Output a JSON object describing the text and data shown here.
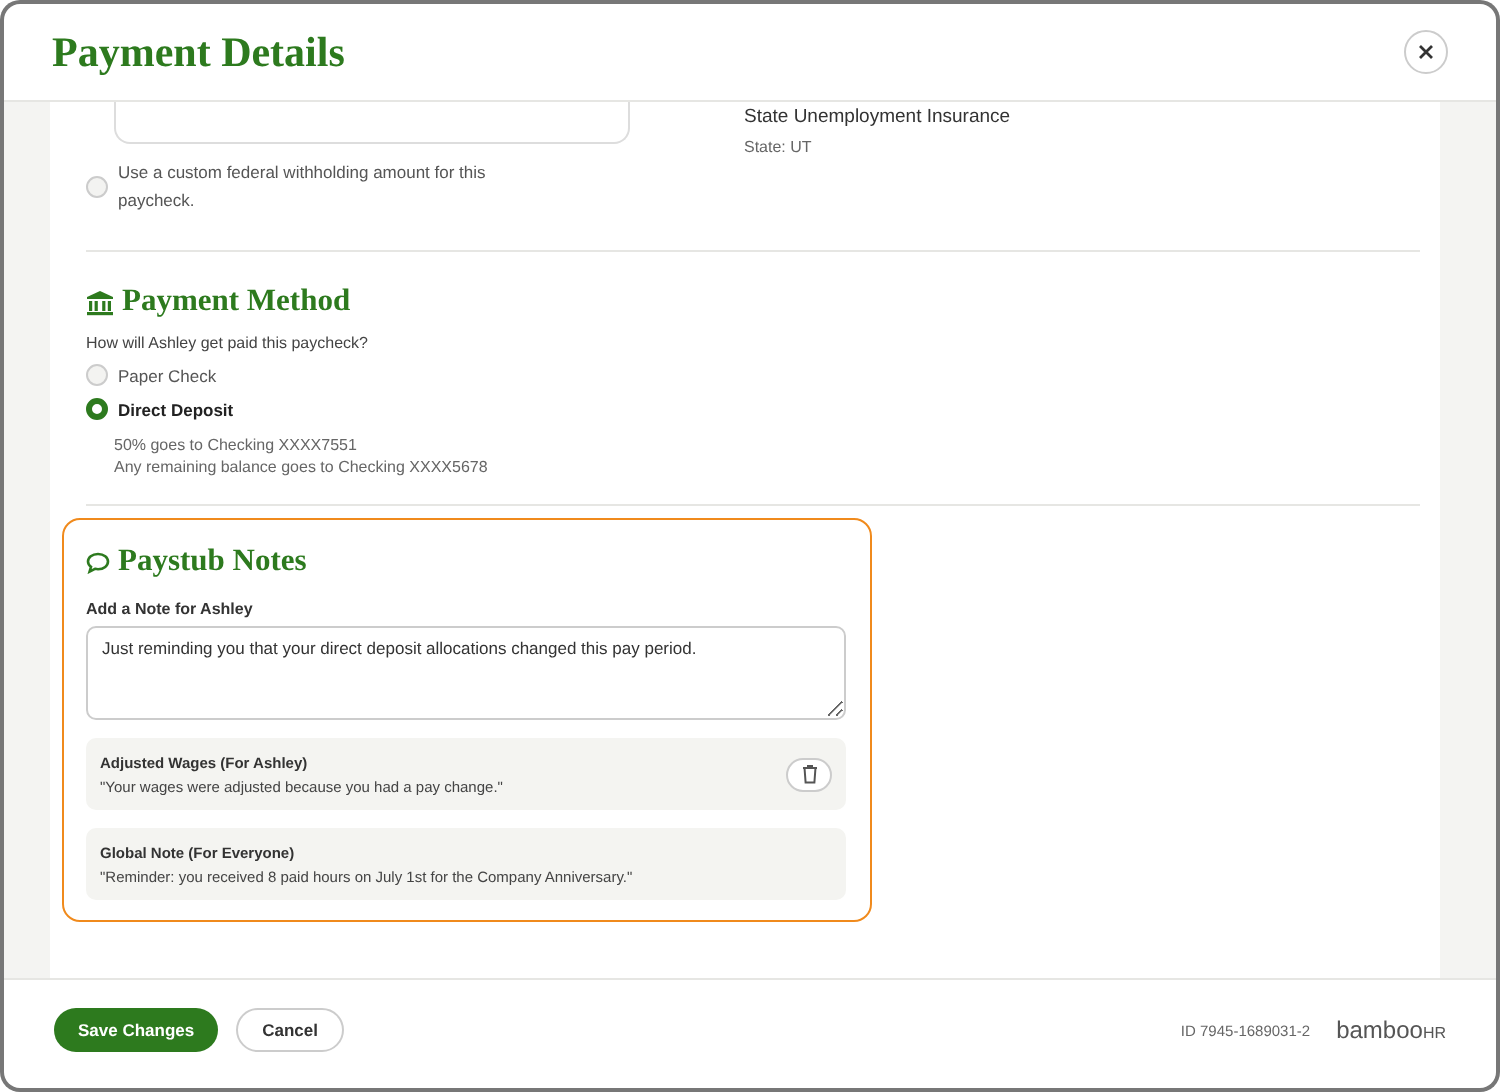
{
  "window": {
    "title": "Payment Details"
  },
  "withholding": {
    "option": {
      "label": "Use a custom federal withholding amount for this paycheck.",
      "selected": false
    }
  },
  "tax_info": {
    "title": "State Unemployment Insurance",
    "detail": "State: UT"
  },
  "payment_method": {
    "heading": "Payment Method",
    "question": "How will Ashley get paid this paycheck?",
    "options": [
      {
        "label": "Paper Check",
        "selected": false
      },
      {
        "label": "Direct Deposit",
        "selected": true
      }
    ],
    "details": [
      "50% goes to Checking XXXX7551",
      "Any remaining balance goes to Checking XXXX5678"
    ]
  },
  "paystub_notes": {
    "heading": "Paystub Notes",
    "field_label": "Add a Note for Ashley",
    "note_value": "Just reminding you that your direct deposit allocations changed this pay period.",
    "notes": [
      {
        "title": "Adjusted Wages (For Ashley)",
        "text": "\"Your wages were adjusted because you had a pay change.\"",
        "deletable": true
      },
      {
        "title": "Global Note (For Everyone)",
        "text": "\"Reminder: you received 8 paid hours on July 1st for the Company Anniversary.\"",
        "deletable": false
      }
    ]
  },
  "footer": {
    "buttons": [
      {
        "label": "Save Changes",
        "kind": "primary"
      },
      {
        "label": "Cancel",
        "kind": "secondary"
      }
    ],
    "id": "ID 7945-1689031-2",
    "logo": {
      "main": "bamboo",
      "suffix": "HR"
    }
  }
}
